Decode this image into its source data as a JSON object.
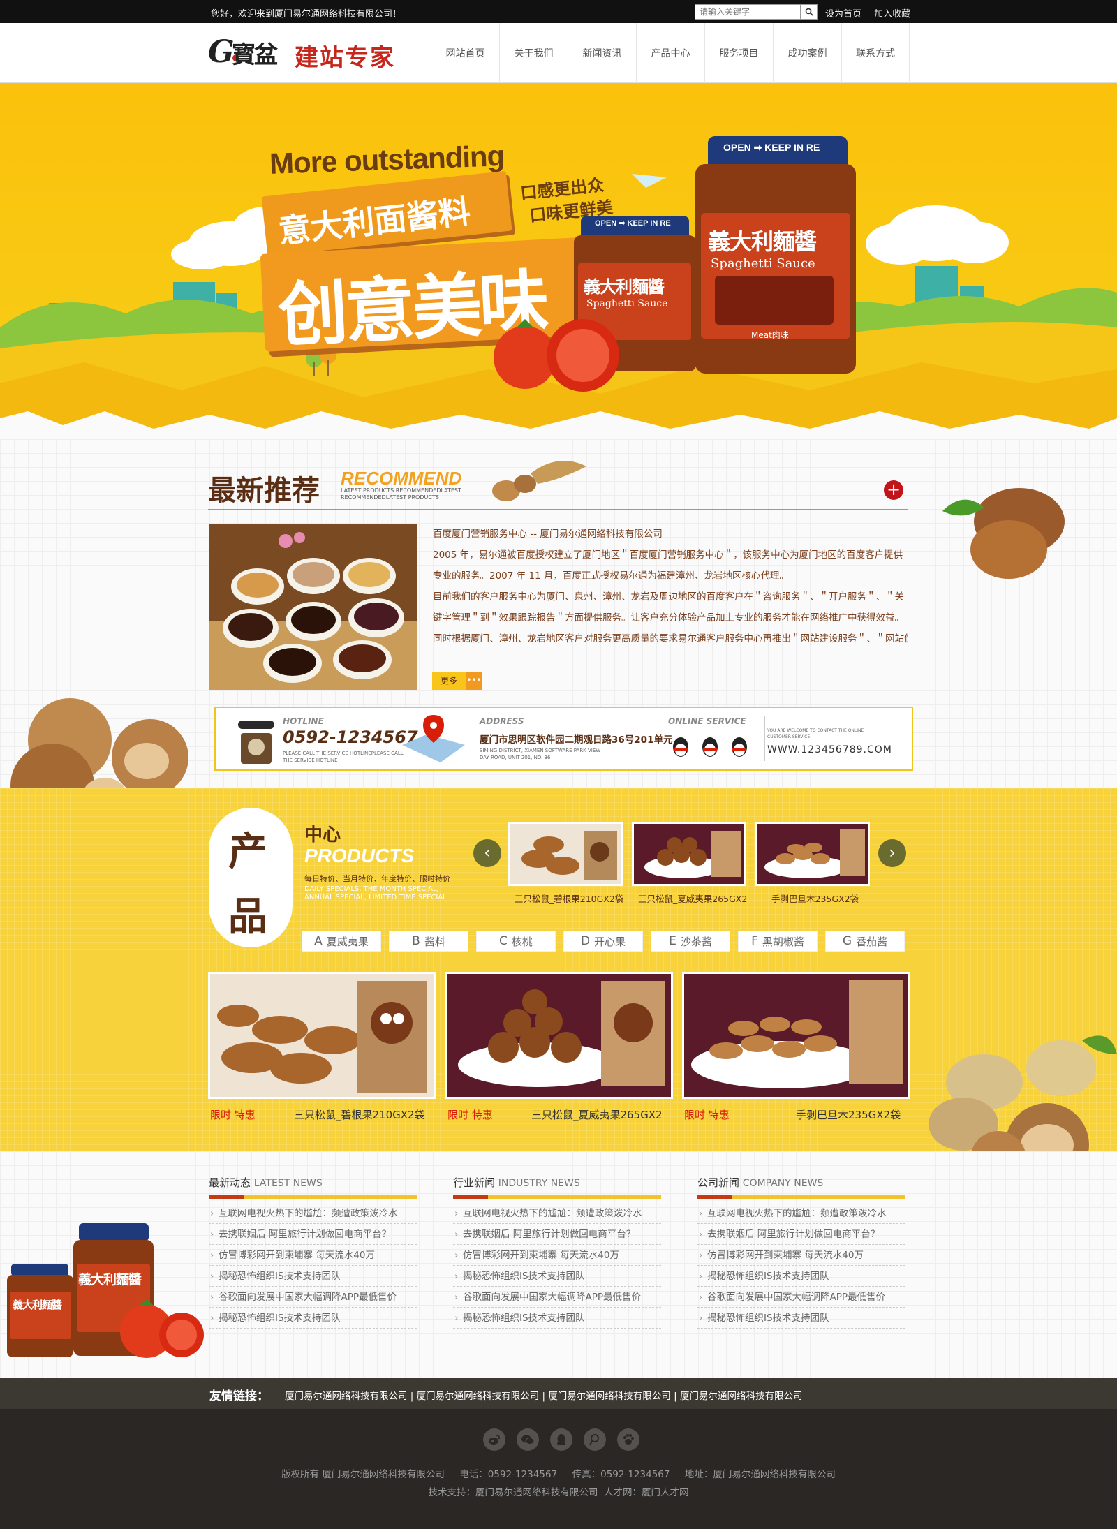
{
  "topbar": {
    "welcome": "您好，欢迎来到厦门易尔通网络科技有限公司！",
    "search_placeholder": "请输入关键字",
    "links": [
      "设为首页",
      "加入收藏"
    ]
  },
  "logo": {
    "brand": "寳盆",
    "slogan": "建站专家"
  },
  "nav": [
    "网站首页",
    "关于我们",
    "新闻资讯",
    "产品中心",
    "服务项目",
    "成功案例",
    "联系方式"
  ],
  "banner": {
    "en_headline": "More outstanding",
    "line1": "意大利面酱料",
    "line2": "创意美味",
    "tag1": "口感更出众",
    "tag2": "口味更鲜美",
    "jar_label_cn": "義大利麵醬",
    "jar_label_en": "Spaghetti Sauce",
    "jar_lid": "OPEN ➡  KEEP IN RE",
    "jar_meat": "Meat肉味"
  },
  "recommend": {
    "title_cn": "最新推荐",
    "title_en": "RECOMMEND",
    "sub_en1": "LATEST PRODUCTS RECOMMENDEDLATEST",
    "sub_en2": "RECOMMENDEDLATEST PRODUCTS",
    "plus": "+",
    "heading": "百度厦门营销服务中心 -- 厦门易尔通网络科技有限公司",
    "p1": "2005 年，易尔通被百度授权建立了厦门地区＂百度厦门营销服务中心＂，该服务中心为厦门地区的百度客户提供专业的服务。2007 年 11 月，百度正式授权易尔通为福建漳州、龙岩地区核心代理。",
    "p2": "目前我们的客户服务中心为厦门、泉州、漳州、龙岩及周边地区的百度客户在＂咨询服务＂、＂开户服务＂、＂关键字管理＂到＂效果跟踪报告＂方面提供服务。让客户充分体验产品加上专业的服务才能在网络推广中获得效益。",
    "p3": "同时根据厦门、漳州、龙岩地区客户对服务更高质量的要求易尔通客户服务中心再推出＂网站建设服务＂、＂网站优化服务＂、＂关键字效果分析服务＂到＂企业网络推广综合报告服务＂一系列专业服务，保证让客户能从",
    "more": "更多"
  },
  "contact": {
    "hotline_label": "HOTLINE",
    "phone": "0592-1234567",
    "hotline_note1": "PLEASE CALL THE SERVICE HOTLINEPLEASE CALL",
    "hotline_note2": "THE SERVICE HOTLINE",
    "address_label": "ADDRESS",
    "address": "厦门市思明区软件园二期观日路36号201单元",
    "address_en1": "SIMING DISTRICT, XIAMEN SOFTWARE PARK VIEW",
    "address_en2": "DAY ROAD, UNIT 201, NO. 36",
    "online_label": "ONLINE SERVICE",
    "welcome_en1": "YOU ARE WELCOME TO CONTACT THE ONLINE",
    "welcome_en2": "CUSTOMER SERVICE",
    "website": "WWW.123456789.COM"
  },
  "products": {
    "badge_top": "产",
    "badge_bottom": "品",
    "title_cn": "中心",
    "title_en": "PRODUCTS",
    "desc_cn": "每日特价、当月特价、年度特价、限时特价",
    "desc_en1": "DAILY SPECIALS, THE MONTH SPECIAL,",
    "desc_en2": "ANNUAL SPECIAL, LIMITED TIME SPECIAL",
    "carousel": [
      "三只松鼠_碧根果210GX2袋",
      "三只松鼠_夏威夷果265GX2",
      "手剥巴旦木235GX2袋"
    ],
    "tabs": [
      {
        "letter": "A",
        "label": "夏威夷果"
      },
      {
        "letter": "B",
        "label": "酱料"
      },
      {
        "letter": "C",
        "label": "核桃"
      },
      {
        "letter": "D",
        "label": "开心果"
      },
      {
        "letter": "E",
        "label": "沙茶酱"
      },
      {
        "letter": "F",
        "label": "黑胡椒酱"
      },
      {
        "letter": "G",
        "label": "番茄酱"
      }
    ],
    "items": [
      {
        "promo": "限时 特惠",
        "name": "三只松鼠_碧根果210GX2袋"
      },
      {
        "promo": "限时 特惠",
        "name": "三只松鼠_夏威夷果265GX2"
      },
      {
        "promo": "限时 特惠",
        "name": "手剥巴旦木235GX2袋"
      }
    ]
  },
  "news": [
    {
      "cn": "最新动态",
      "en": "LATEST NEWS",
      "items": [
        "互联网电视火热下的尴尬：频遭政策泼冷水",
        "去携联姻后 阿里旅行计划做回电商平台？",
        "仿冒博彩网开到柬埔寨 每天流水40万",
        "揭秘恐怖组织IS技术支持团队",
        "谷歌面向发展中国家大幅调降APP最低售价",
        "揭秘恐怖组织IS技术支持团队"
      ]
    },
    {
      "cn": "行业新闻",
      "en": "INDUSTRY NEWS",
      "items": [
        "互联网电视火热下的尴尬：频遭政策泼冷水",
        "去携联姻后 阿里旅行计划做回电商平台？",
        "仿冒博彩网开到柬埔寨 每天流水40万",
        "揭秘恐怖组织IS技术支持团队",
        "谷歌面向发展中国家大幅调降APP最低售价",
        "揭秘恐怖组织IS技术支持团队"
      ]
    },
    {
      "cn": "公司新闻",
      "en": "COMPANY NEWS",
      "items": [
        "互联网电视火热下的尴尬：频遭政策泼冷水",
        "去携联姻后 阿里旅行计划做回电商平台？",
        "仿冒博彩网开到柬埔寨 每天流水40万",
        "揭秘恐怖组织IS技术支持团队",
        "谷歌面向发展中国家大幅调降APP最低售价",
        "揭秘恐怖组织IS技术支持团队"
      ]
    }
  ],
  "friend_links": {
    "label": "友情链接：",
    "links": [
      "厦门易尔通网络科技有限公司",
      "厦门易尔通网络科技有限公司",
      "厦门易尔通网络科技有限公司",
      "厦门易尔通网络科技有限公司"
    ],
    "sep": "|"
  },
  "footer": {
    "social_icons": [
      "weibo-icon",
      "wechat-icon",
      "qq-icon",
      "tencent-weibo-icon",
      "baidu-icon"
    ],
    "line1": "版权所有 厦门易尔通网络科技有限公司     电话：0592-1234567     传真：0592-1234567     地址：厦门易尔通网络科技有限公司",
    "line2": "技术支持：厦门易尔通网络科技有限公司  人才网：厦门人才网"
  },
  "colors": {
    "accent_yellow": "#f8c913",
    "brown": "#5a2e14",
    "red": "#d81e06",
    "footer_dark": "#2a2725"
  }
}
